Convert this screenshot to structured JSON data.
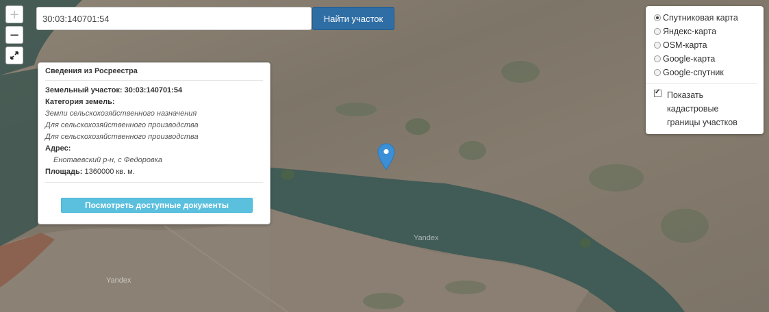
{
  "map": {
    "watermark_1": "Yandex",
    "watermark_2": "Yandex"
  },
  "zoom": {
    "in_label": "+",
    "out_label": "−",
    "fullscreen_icon": "expand-icon"
  },
  "search": {
    "value": "30:03:140701:54",
    "button_label": "Найти участок"
  },
  "info": {
    "title": "Сведения из Росреестра",
    "parcel_label": "Земельный участок:",
    "parcel_value": "30:03:140701:54",
    "category_label": "Категория земель:",
    "category_lines": [
      "Земли сельскохозяйственного назначения",
      "Для сельскохозяйственного производства",
      "Для сельскохозяйственного производства"
    ],
    "address_label": "Адрес:",
    "address_value": "Енотаевский р-н, с Федоровка",
    "area_label": "Площадь:",
    "area_value": "1360000 кв. м.",
    "docs_button": "Посмотреть доступные документы"
  },
  "layers": {
    "options": [
      {
        "label": "Спутниковая карта",
        "checked": true
      },
      {
        "label": "Яндекс-карта",
        "checked": false
      },
      {
        "label": "OSM-карта",
        "checked": false
      },
      {
        "label": "Google-карта",
        "checked": false
      },
      {
        "label": "Google-спутник",
        "checked": false
      }
    ],
    "cadastral_label": "Показать кадастровые границы участков",
    "cadastral_checked": true
  },
  "colors": {
    "accent": "#2f6ea5",
    "docs_button": "#5bc0de",
    "marker": "#3a8fd6"
  }
}
